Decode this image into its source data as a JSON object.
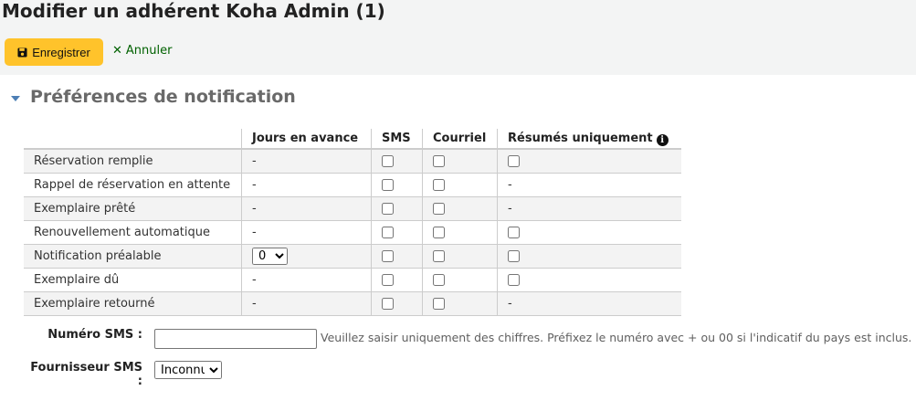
{
  "header": {
    "title": "Modifier un adhérent Koha Admin (1)",
    "save_label": "Enregistrer",
    "cancel_label": "Annuler"
  },
  "section": {
    "title": "Préférences de notification"
  },
  "table": {
    "headers": {
      "days": "Jours en avance",
      "sms": "SMS",
      "email": "Courriel",
      "digest": "Résumés uniquement"
    },
    "rows": [
      {
        "name": "Réservation remplie",
        "days": "-",
        "digest": "checkbox"
      },
      {
        "name": "Rappel de réservation en attente",
        "days": "-",
        "digest": "-"
      },
      {
        "name": "Exemplaire prêté",
        "days": "-",
        "digest": "-"
      },
      {
        "name": "Renouvellement automatique",
        "days": "-",
        "digest": "checkbox"
      },
      {
        "name": "Notification préalable",
        "days_select": "0",
        "digest": "checkbox"
      },
      {
        "name": "Exemplaire dû",
        "days": "-",
        "digest": "checkbox"
      },
      {
        "name": "Exemplaire retourné",
        "days": "-",
        "digest": "-"
      }
    ]
  },
  "sms_number": {
    "label": "Numéro SMS :",
    "value": "",
    "hint": "Veuillez saisir uniquement des chiffres. Préfixez le numéro avec + ou 00 si l'indicatif du pays est inclus."
  },
  "sms_provider": {
    "label": "Fournisseur SMS :",
    "selected": "Inconnu"
  },
  "colors": {
    "save_button": "#ffc32b",
    "cancel_link": "#006100",
    "caret": "#4d7fb5"
  }
}
